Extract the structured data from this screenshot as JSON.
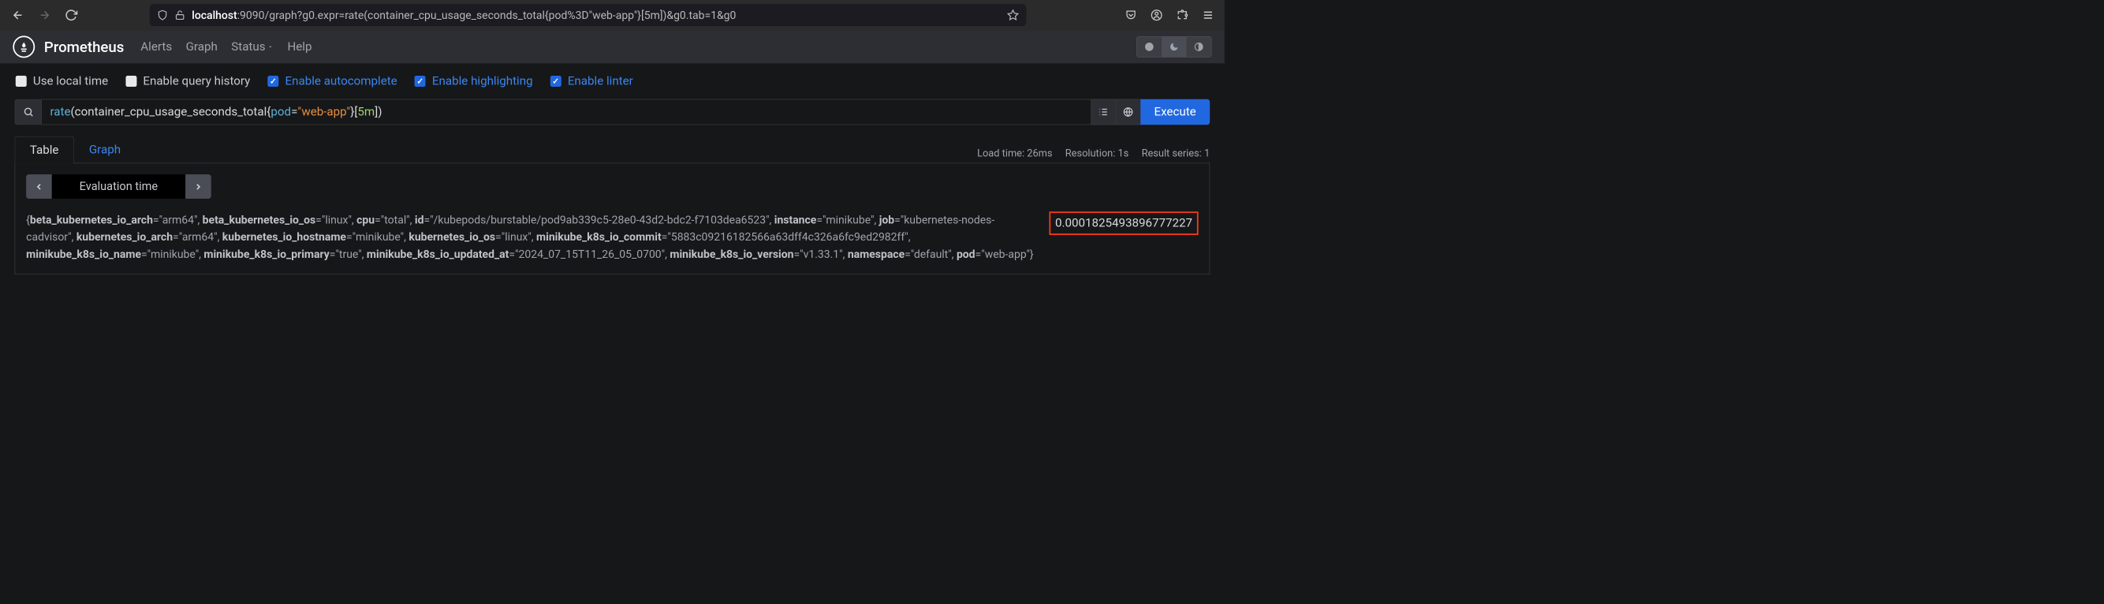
{
  "browser": {
    "url_prefix": "localhost",
    "url_rest": ":9090/graph?g0.expr=rate(container_cpu_usage_seconds_total{pod%3D\"web-app\"}[5m])&g0.tab=1&g0"
  },
  "nav": {
    "brand": "Prometheus",
    "links": {
      "alerts": "Alerts",
      "graph": "Graph",
      "status": "Status",
      "help": "Help"
    }
  },
  "options": {
    "local_time": "Use local time",
    "query_history": "Enable query history",
    "autocomplete": "Enable autocomplete",
    "highlighting": "Enable highlighting",
    "linter": "Enable linter"
  },
  "query": {
    "fn": "rate",
    "open_paren": "(",
    "metric": "container_cpu_usage_seconds_total",
    "open_brace": "{",
    "label": "pod",
    "eq": "=",
    "str": "\"web-app\"",
    "close_brace": "}",
    "open_brack": "[",
    "dur": "5m",
    "close_brack": "]",
    "close_paren": ")",
    "execute": "Execute"
  },
  "tabs": {
    "table": "Table",
    "graph": "Graph"
  },
  "stats": {
    "load": "Load time: 26ms",
    "resolution": "Resolution: 1s",
    "series": "Result series: 1"
  },
  "eval": {
    "label": "Evaluation time"
  },
  "result": {
    "value": "0.0001825493896777227",
    "labels": [
      {
        "k": "beta_kubernetes_io_arch",
        "v": "\"arm64\""
      },
      {
        "k": "beta_kubernetes_io_os",
        "v": "\"linux\""
      },
      {
        "k": "cpu",
        "v": "\"total\""
      },
      {
        "k": "id",
        "v": "\"/kubepods/burstable/pod9ab339c5-28e0-43d2-bdc2-f7103dea6523\""
      },
      {
        "k": "instance",
        "v": "\"minikube\""
      },
      {
        "k": "job",
        "v": "\"kubernetes-nodes-cadvisor\""
      },
      {
        "k": "kubernetes_io_arch",
        "v": "\"arm64\""
      },
      {
        "k": "kubernetes_io_hostname",
        "v": "\"minikube\""
      },
      {
        "k": "kubernetes_io_os",
        "v": "\"linux\""
      },
      {
        "k": "minikube_k8s_io_commit",
        "v": "\"5883c09216182566a63dff4c326a6fc9ed2982ff\""
      },
      {
        "k": "minikube_k8s_io_name",
        "v": "\"minikube\""
      },
      {
        "k": "minikube_k8s_io_primary",
        "v": "\"true\""
      },
      {
        "k": "minikube_k8s_io_updated_at",
        "v": "\"2024_07_15T11_26_05_0700\""
      },
      {
        "k": "minikube_k8s_io_version",
        "v": "\"v1.33.1\""
      },
      {
        "k": "namespace",
        "v": "\"default\""
      },
      {
        "k": "pod",
        "v": "\"web-app\""
      }
    ]
  }
}
